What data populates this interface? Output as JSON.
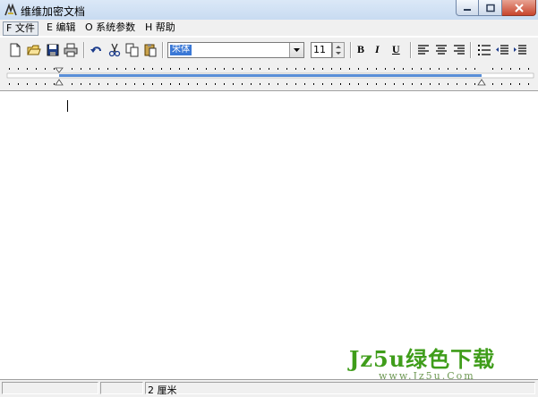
{
  "window": {
    "title": "维维加密文档"
  },
  "menu": [
    {
      "label": "F 文件"
    },
    {
      "label": "E 编辑"
    },
    {
      "label": "O 系统参数"
    },
    {
      "label": "H 帮助"
    }
  ],
  "toolbar": {
    "font_name": "宋体",
    "font_size": "11",
    "buttons": [
      "new-icon",
      "open-icon",
      "save-icon",
      "print-icon",
      "undo-icon",
      "cut-icon",
      "copy-icon",
      "paste-icon",
      "bold-icon",
      "italic-icon",
      "underline-icon",
      "align-left-icon",
      "align-center-icon",
      "align-right-icon",
      "bullets-icon",
      "outdent-icon",
      "indent-icon"
    ],
    "bold_glyph": "B",
    "italic_glyph": "I",
    "underline_glyph": "U"
  },
  "status": {
    "unit": "2 厘米"
  },
  "watermark": {
    "logo": "Jz5u绿色下载",
    "url": "www.Jz5u.Com"
  },
  "colors": {
    "titlebar": "#c8dbf1",
    "selection": "#3a78d6",
    "watermark": "#3f9d1a"
  }
}
